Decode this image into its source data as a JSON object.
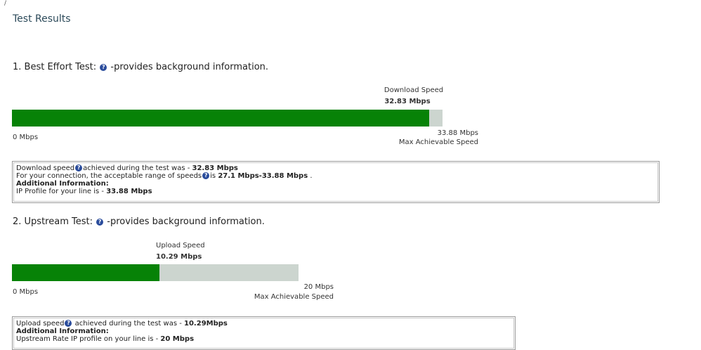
{
  "page": {
    "title": "Test Results"
  },
  "best_effort": {
    "heading": "1. Best Effort Test:",
    "heading_suffix": "-provides background information.",
    "speed_caption": "Download Speed",
    "speed_value": "32.83 Mbps",
    "min_label": "0 Mbps",
    "max_value": "33.88 Mbps",
    "max_caption": "Max Achievable Speed",
    "fill_fraction": 0.969,
    "details": {
      "line1_prefix": "Download speed",
      "line1_mid": "achieved during the test was - ",
      "line1_value": "32.83 Mbps",
      "line2_prefix": "For your connection, the acceptable range of speeds",
      "line2_mid": "is ",
      "line2_value": "27.1 Mbps-33.88 Mbps",
      "line2_suffix": " .",
      "additional_heading": "Additional Information:",
      "line4_prefix": "IP Profile for your line is - ",
      "line4_value": "33.88 Mbps"
    }
  },
  "upstream": {
    "heading": "2. Upstream Test:",
    "heading_suffix": "-provides background information.",
    "speed_caption": "Upload Speed",
    "speed_value": "10.29 Mbps",
    "min_label": "0 Mbps",
    "max_value": "20 Mbps",
    "max_caption": "Max Achievable Speed",
    "fill_fraction": 0.5145,
    "details": {
      "line1_prefix": "Upload speed",
      "line1_mid": " achieved during the test was - ",
      "line1_value": "10.29Mbps",
      "additional_heading": "Additional Information:",
      "line3_prefix": "Upstream Rate IP profile on your line is - ",
      "line3_value": "20 Mbps"
    }
  },
  "icons": {
    "info": "question-icon"
  },
  "colors": {
    "bar_fill": "#078207",
    "bar_track": "#ccd5cf",
    "title": "#2c4a5a"
  }
}
